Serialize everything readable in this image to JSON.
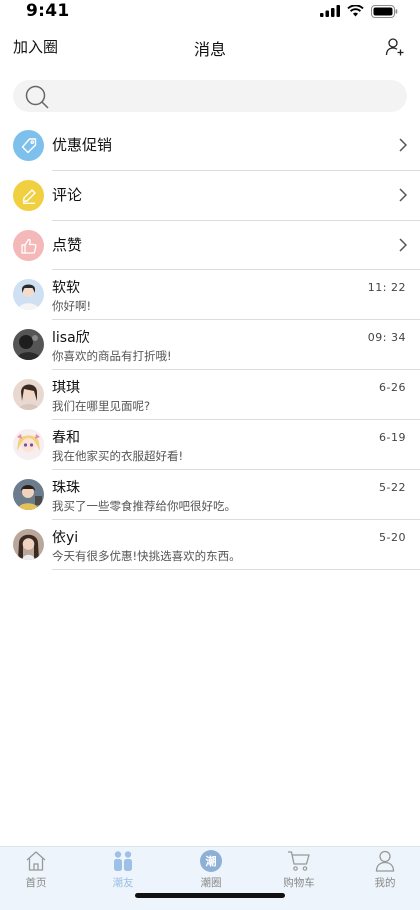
{
  "status": {
    "time": "9:41"
  },
  "nav": {
    "left_label": "加入圈",
    "title": "消息",
    "right_icon": "add-user-icon"
  },
  "search": {
    "placeholder": ""
  },
  "categories": [
    {
      "label": "优惠促销",
      "icon": "tag-icon",
      "color": "#7ec0ec"
    },
    {
      "label": "评论",
      "icon": "pencil-icon",
      "color": "#f0d040"
    },
    {
      "label": "点赞",
      "icon": "thumbs-up-icon",
      "color": "#f5b8b8"
    }
  ],
  "conversations": [
    {
      "name": "软软",
      "message": "你好啊!",
      "time": "11: 22"
    },
    {
      "name": "lisa欣",
      "message": "你喜欢的商品有打折哦!",
      "time": "09: 34"
    },
    {
      "name": "琪琪",
      "message": "我们在哪里见面呢?",
      "time": "6-26"
    },
    {
      "name": "春和",
      "message": "我在他家买的衣服超好看!",
      "time": "6-19"
    },
    {
      "name": "珠珠",
      "message": "我买了一些零食推荐给你吧很好吃。",
      "time": "5-22"
    },
    {
      "name": "依yi",
      "message": "今天有很多优惠!快挑选喜欢的东西。",
      "time": "5-20"
    }
  ],
  "tabs": [
    {
      "label": "首页",
      "icon": "home-icon"
    },
    {
      "label": "潮友",
      "icon": "friends-icon"
    },
    {
      "label": "潮圈",
      "icon": "circle-icon",
      "badge_char": "潮"
    },
    {
      "label": "购物车",
      "icon": "cart-icon"
    },
    {
      "label": "我的",
      "icon": "profile-icon"
    }
  ],
  "active_tab": "潮友",
  "colors": {
    "accent": "#9cc0e6",
    "tabbar_bg": "#eef4fb"
  }
}
